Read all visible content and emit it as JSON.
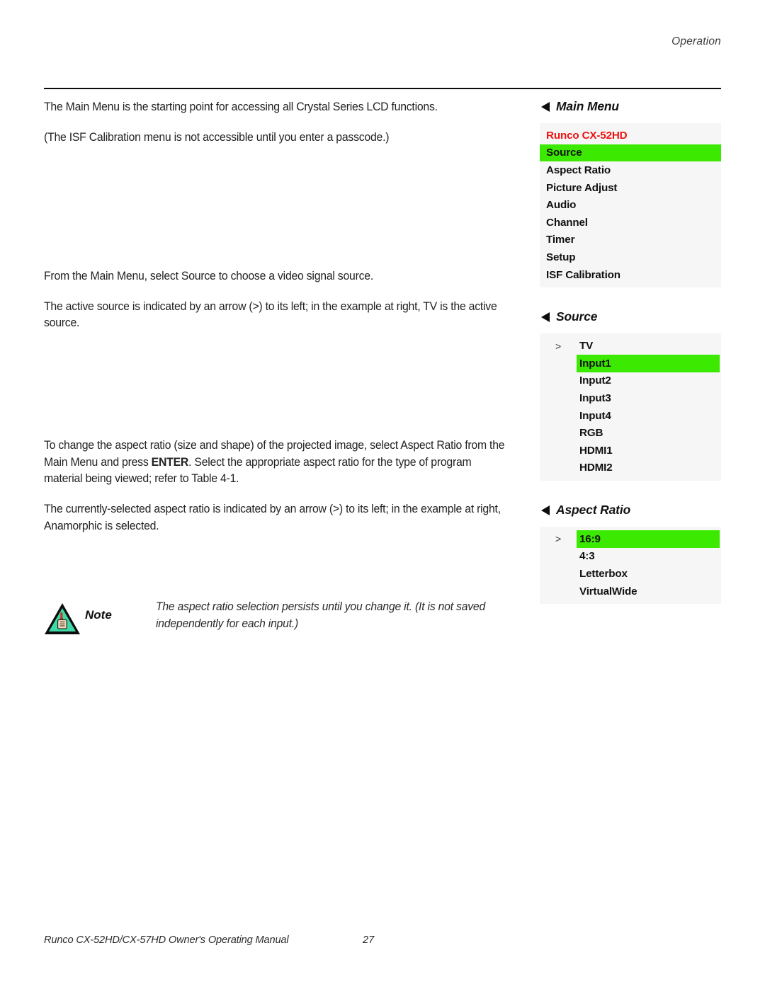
{
  "header": {
    "running_head": "Operation"
  },
  "body": {
    "paragraphs": [
      "The Main Menu is the starting point for accessing all Crystal Series LCD functions.",
      "(The ISF Calibration menu is not accessible until you enter a passcode.)",
      "From the Main Menu, select Source to choose a video signal source.",
      "The active source is indicated by an arrow (>) to its left; in the example at right, TV is the active source."
    ],
    "aspect_para_1a": "To change the aspect ratio (size and shape) of the projected image, select Aspect Ratio from the Main Menu and press ",
    "aspect_para_1b": "ENTER",
    "aspect_para_1c": ". Select the appropriate aspect ratio for the type of program material being viewed; refer to Table 4-1.",
    "aspect_para_2": "The currently-selected aspect ratio is indicated by an arrow (>) to its left; in the example at right, Anamorphic is selected."
  },
  "note": {
    "icon": "note-triangle-hand-icon",
    "label": "Note",
    "text": "The aspect ratio selection persists until you change it. (It is not saved independently for each input.)"
  },
  "osd": {
    "colors": {
      "highlight": "#3bea00",
      "title_red": "#ee1111",
      "panel_bg": "#f6f6f6"
    },
    "panels": [
      {
        "heading": "Main Menu",
        "style": "flat",
        "rows": [
          {
            "marker": "",
            "label": "Runco CX-52HD",
            "highlight": false,
            "title": true
          },
          {
            "marker": "",
            "label": "Source",
            "highlight": true,
            "title": false
          },
          {
            "marker": "",
            "label": "Aspect Ratio",
            "highlight": false,
            "title": false
          },
          {
            "marker": "",
            "label": "Picture Adjust",
            "highlight": false,
            "title": false
          },
          {
            "marker": "",
            "label": "Audio",
            "highlight": false,
            "title": false
          },
          {
            "marker": "",
            "label": "Channel",
            "highlight": false,
            "title": false
          },
          {
            "marker": "",
            "label": "Timer",
            "highlight": false,
            "title": false
          },
          {
            "marker": "",
            "label": "Setup",
            "highlight": false,
            "title": false
          },
          {
            "marker": "",
            "label": "ISF Calibration",
            "highlight": false,
            "title": false
          }
        ]
      },
      {
        "heading": "Source",
        "style": "indent",
        "rows": [
          {
            "marker": ">",
            "label": "TV",
            "highlight": false,
            "title": false
          },
          {
            "marker": "",
            "label": "Input1",
            "highlight": true,
            "title": false
          },
          {
            "marker": "",
            "label": "Input2",
            "highlight": false,
            "title": false
          },
          {
            "marker": "",
            "label": "Input3",
            "highlight": false,
            "title": false
          },
          {
            "marker": "",
            "label": "Input4",
            "highlight": false,
            "title": false
          },
          {
            "marker": "",
            "label": "RGB",
            "highlight": false,
            "title": false
          },
          {
            "marker": "",
            "label": "HDMI1",
            "highlight": false,
            "title": false
          },
          {
            "marker": "",
            "label": "HDMI2",
            "highlight": false,
            "title": false
          }
        ]
      },
      {
        "heading": "Aspect Ratio",
        "style": "indent",
        "rows": [
          {
            "marker": ">",
            "label": "16:9",
            "highlight": true,
            "title": false
          },
          {
            "marker": "",
            "label": "4:3",
            "highlight": false,
            "title": false
          },
          {
            "marker": "",
            "label": "Letterbox",
            "highlight": false,
            "title": false
          },
          {
            "marker": "",
            "label": "VirtualWide",
            "highlight": false,
            "title": false
          }
        ]
      }
    ]
  },
  "footer": {
    "manual": "Runco CX-52HD/CX-57HD Owner's Operating Manual",
    "page": "27"
  }
}
